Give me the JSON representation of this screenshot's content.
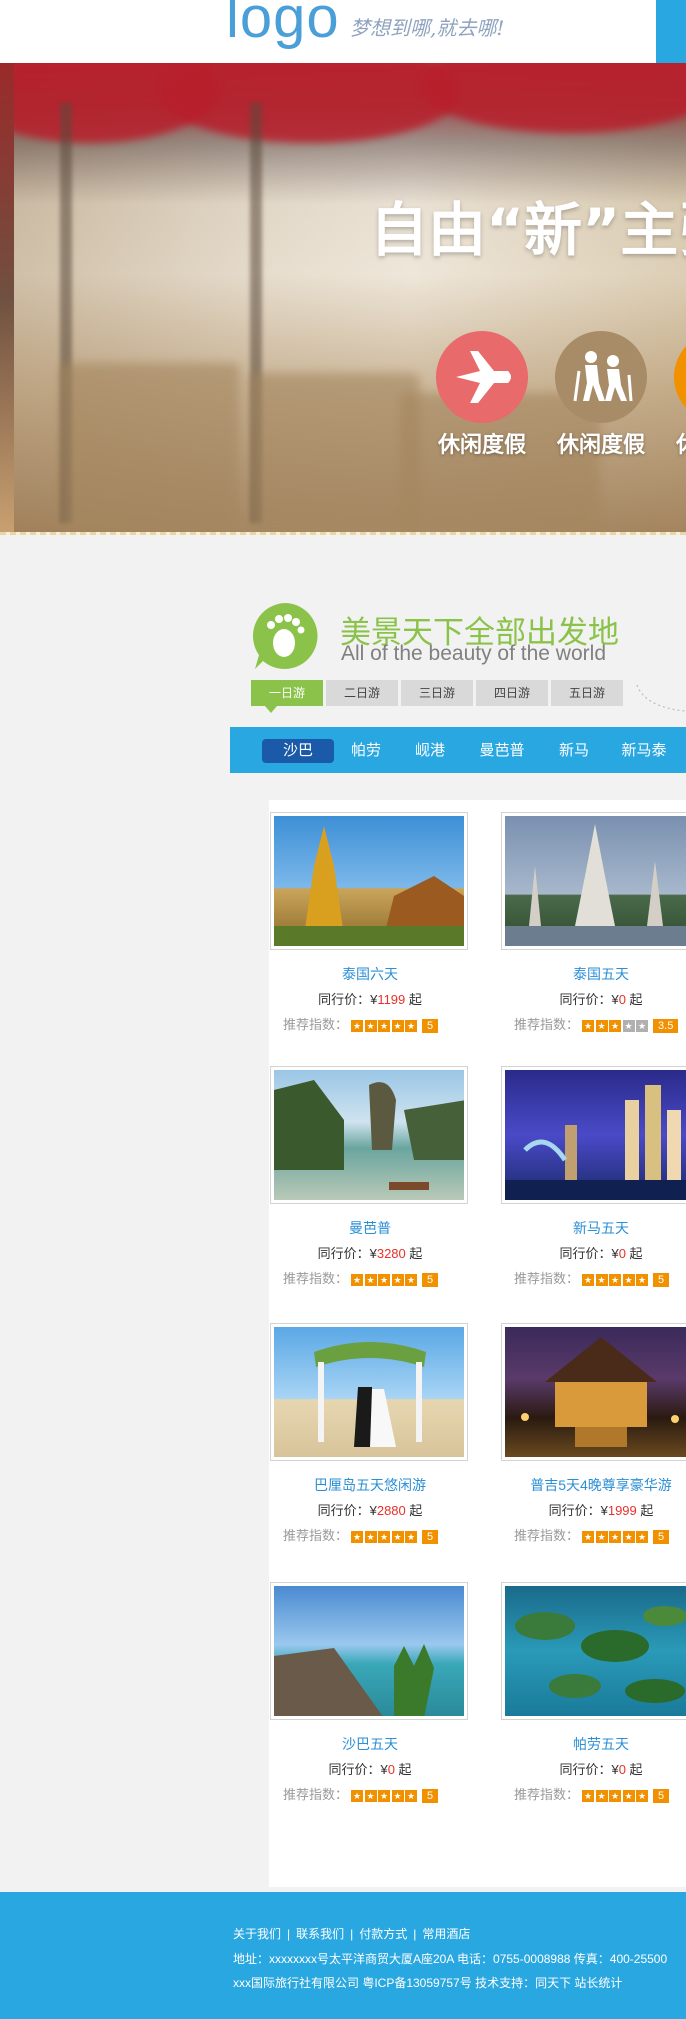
{
  "header": {
    "logo": "logo",
    "slogan": "梦想到哪,就去哪!"
  },
  "banner": {
    "title": "自由“新”主张",
    "categories": [
      {
        "label": "休闲度假",
        "icon": "airplane-icon",
        "color": "#e86a6a"
      },
      {
        "label": "休闲度假",
        "icon": "hikers-icon",
        "color": "#a88c68"
      },
      {
        "label": "休",
        "icon": "circle-icon",
        "color": "#f29100"
      }
    ]
  },
  "section": {
    "title": "美景天下全部出发地",
    "subtitle": "All of the beauty of the world",
    "icon": "footprint-icon",
    "day_tabs": [
      "一日游",
      "二日游",
      "三日游",
      "四日游",
      "五日游"
    ],
    "active_day": 0
  },
  "destinations": {
    "tabs": [
      "沙巴",
      "帕劳",
      "岘港",
      "曼芭普",
      "新马",
      "新马泰"
    ],
    "active": 0
  },
  "products": [
    {
      "name": "泰国六天",
      "price_label": "同行价：",
      "currency": "¥",
      "price": "1199",
      "suffix": "起",
      "rating_label": "推荐指数：",
      "stars": 5,
      "score": "5"
    },
    {
      "name": "泰国五天",
      "price_label": "同行价：",
      "currency": "¥",
      "price": "0",
      "suffix": "起",
      "rating_label": "推荐指数：",
      "stars": 3.5,
      "score": "3.5"
    },
    {
      "name": "曼芭普",
      "price_label": "同行价：",
      "currency": "¥",
      "price": "3280",
      "suffix": "起",
      "rating_label": "推荐指数：",
      "stars": 5,
      "score": "5"
    },
    {
      "name": "新马五天",
      "price_label": "同行价：",
      "currency": "¥",
      "price": "0",
      "suffix": "起",
      "rating_label": "推荐指数：",
      "stars": 5,
      "score": "5"
    },
    {
      "name": "巴厘岛五天悠闲游",
      "price_label": "同行价：",
      "currency": "¥",
      "price": "2880",
      "suffix": "起",
      "rating_label": "推荐指数：",
      "stars": 5,
      "score": "5"
    },
    {
      "name": "普吉5天4晚尊享豪华游",
      "price_label": "同行价：",
      "currency": "¥",
      "price": "1999",
      "suffix": "起",
      "rating_label": "推荐指数：",
      "stars": 5,
      "score": "5"
    },
    {
      "name": "沙巴五天",
      "price_label": "同行价：",
      "currency": "¥",
      "price": "0",
      "suffix": "起",
      "rating_label": "推荐指数：",
      "stars": 5,
      "score": "5"
    },
    {
      "name": "帕劳五天",
      "price_label": "同行价：",
      "currency": "¥",
      "price": "0",
      "suffix": "起",
      "rating_label": "推荐指数：",
      "stars": 5,
      "score": "5"
    }
  ],
  "footer": {
    "links": [
      "关于我们",
      "联系我们",
      "付款方式",
      "常用酒店"
    ],
    "address": "地址：xxxxxxxx号太平洋商贸大厦A座20A  电话：0755-0008988  传真：400-25500",
    "company": "xxx国际旅行社有限公司  粤ICP备13059757号  技术支持：同天下  站长统计"
  },
  "colors": {
    "brand_blue": "#29a7e1",
    "accent_green": "#8bc34a",
    "price_red": "#e8312a",
    "star_orange": "#f29100",
    "active_tab": "#1a5aa8"
  }
}
